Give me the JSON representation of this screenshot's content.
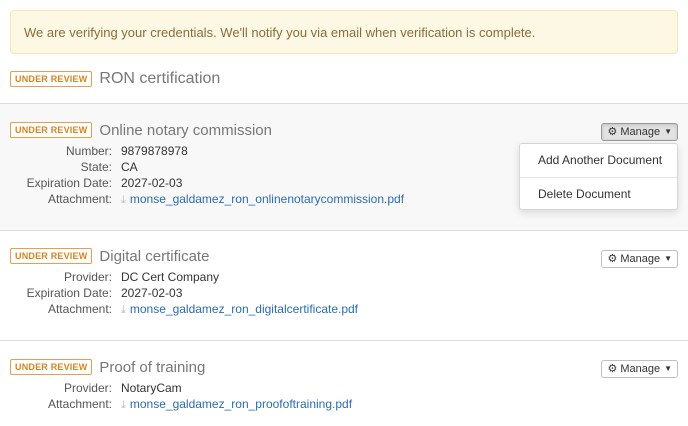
{
  "alert": {
    "text": "We are verifying your credentials. We'll notify you via email when verification is complete."
  },
  "section": {
    "badge": "UNDER REVIEW",
    "title": "RON certification"
  },
  "cards": [
    {
      "badge": "UNDER REVIEW",
      "title": "Online notary commission",
      "manage_label": "Manage",
      "fields": [
        {
          "label": "Number:",
          "value": "9879878978"
        },
        {
          "label": "State:",
          "value": "CA"
        },
        {
          "label": "Expiration Date:",
          "value": "2027-02-03"
        },
        {
          "label": "Attachment:",
          "value": "monse_galdamez_ron_onlinenotarycommission.pdf"
        }
      ]
    },
    {
      "badge": "UNDER REVIEW",
      "title": "Digital certificate",
      "manage_label": "Manage",
      "fields": [
        {
          "label": "Provider:",
          "value": "DC Cert Company"
        },
        {
          "label": "Expiration Date:",
          "value": "2027-02-03"
        },
        {
          "label": "Attachment:",
          "value": "monse_galdamez_ron_digitalcertificate.pdf"
        }
      ]
    },
    {
      "badge": "UNDER REVIEW",
      "title": "Proof of training",
      "manage_label": "Manage",
      "fields": [
        {
          "label": "Provider:",
          "value": "NotaryCam"
        },
        {
          "label": "Attachment:",
          "value": "monse_galdamez_ron_proofoftraining.pdf"
        }
      ]
    }
  ],
  "dropdown": {
    "items": [
      "Add Another Document",
      "Delete Document"
    ]
  },
  "icons": {
    "gear": "gear-icon",
    "caret": "caret-down-icon",
    "download": "download-icon"
  },
  "colors": {
    "alert_bg": "#fcf8e3",
    "alert_text": "#8a6d3b",
    "badge": "#e4a04a",
    "link": "#2a6cb2"
  }
}
